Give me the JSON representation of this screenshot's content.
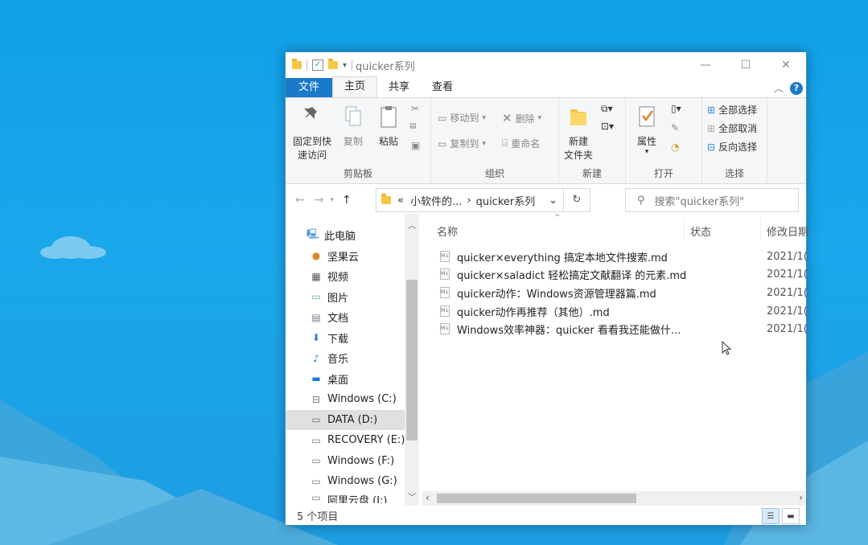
{
  "window": {
    "title": "quicker系列"
  },
  "ribbon_tabs": [
    "文件",
    "主页",
    "共享",
    "查看"
  ],
  "ribbon": {
    "clipboard": {
      "pin_label_1": "固定到快",
      "pin_label_2": "速访问",
      "copy": "复制",
      "paste": "粘贴",
      "group": "剪贴板"
    },
    "organize": {
      "move_to": "移动到",
      "copy_to": "复制到",
      "delete": "删除",
      "rename": "重命名",
      "group": "组织"
    },
    "new": {
      "new_folder_1": "新建",
      "new_folder_2": "文件夹",
      "group": "新建"
    },
    "open": {
      "properties": "属性",
      "group": "打开"
    },
    "select": {
      "select_all": "全部选择",
      "select_none": "全部取消",
      "invert": "反向选择",
      "group": "选择"
    }
  },
  "address": {
    "path_prefix": "«",
    "path_1": "小软件的...",
    "path_sep": "›",
    "path_2": "quicker系列",
    "search_placeholder": "搜索\"quicker系列\""
  },
  "nav": [
    {
      "label": "此电脑",
      "icon": "computer-icon"
    },
    {
      "label": "坚果云",
      "icon": "nut-icon"
    },
    {
      "label": "视频",
      "icon": "video-icon"
    },
    {
      "label": "图片",
      "icon": "picture-icon"
    },
    {
      "label": "文档",
      "icon": "document-icon"
    },
    {
      "label": "下载",
      "icon": "download-icon"
    },
    {
      "label": "音乐",
      "icon": "music-icon"
    },
    {
      "label": "桌面",
      "icon": "desktop-icon"
    },
    {
      "label": "Windows (C:)",
      "icon": "drive-icon"
    },
    {
      "label": "DATA (D:)",
      "icon": "drive-icon",
      "selected": true
    },
    {
      "label": "RECOVERY (E:)",
      "icon": "drive-icon"
    },
    {
      "label": "Windows (F:)",
      "icon": "drive-icon"
    },
    {
      "label": "Windows (G:)",
      "icon": "drive-icon"
    },
    {
      "label": "阿里云盘 (J:)",
      "icon": "drive-icon"
    }
  ],
  "columns": {
    "name": "名称",
    "status": "状态",
    "modified": "修改日期"
  },
  "files": [
    {
      "name": "quicker×everything 搞定本地文件搜索.md",
      "date": "2021/1("
    },
    {
      "name": "quicker×saladict 轻松搞定文献翻译 的元素.md",
      "date": "2021/1("
    },
    {
      "name": "quicker动作：Windows资源管理器篇.md",
      "date": "2021/1("
    },
    {
      "name": "quicker动作再推荐（其他）.md",
      "date": "2021/1("
    },
    {
      "name": "Windows效率神器：quicker 看看我还能做什...",
      "date": "2021/1("
    }
  ],
  "status_bar": {
    "count": "5 个项目"
  }
}
